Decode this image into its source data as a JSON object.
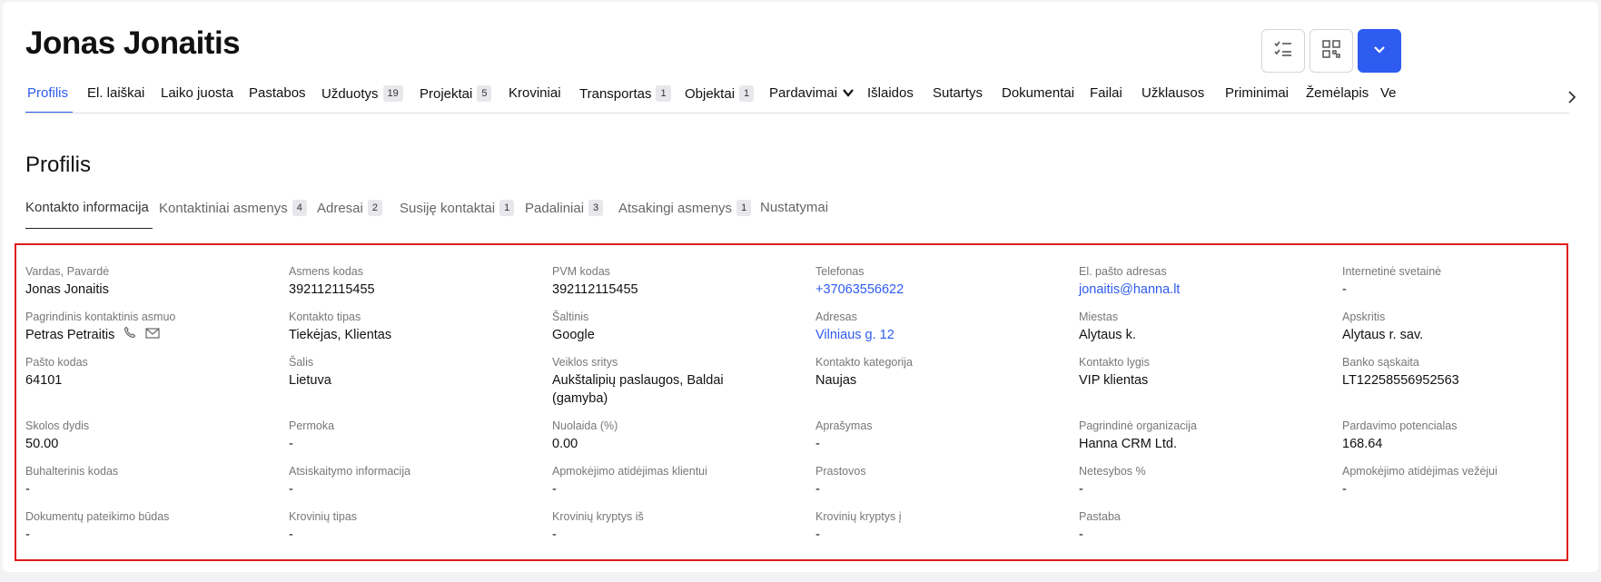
{
  "header": {
    "title": "Jonas Jonaitis"
  },
  "header_buttons": {
    "icons": [
      "checklist-icon",
      "qr-code-icon",
      "chevron-down-icon"
    ]
  },
  "tabs": [
    {
      "label": "Profilis",
      "active": true
    },
    {
      "label": "El. laiškai"
    },
    {
      "label": "Laiko juosta"
    },
    {
      "label": "Pastabos"
    },
    {
      "label": "Užduotys",
      "badge": "19"
    },
    {
      "label": "Projektai",
      "badge": "5"
    },
    {
      "label": "Kroviniai"
    },
    {
      "label": "Transportas",
      "badge": "1"
    },
    {
      "label": "Objektai",
      "badge": "1"
    },
    {
      "label": "Pardavimai",
      "dropdown": true
    },
    {
      "label": "Išlaidos"
    },
    {
      "label": "Sutartys"
    },
    {
      "label": "Dokumentai"
    },
    {
      "label": "Failai"
    },
    {
      "label": "Užklausos"
    },
    {
      "label": "Priminimai"
    },
    {
      "label": "Žemėlapis"
    },
    {
      "label": "Ve"
    }
  ],
  "section": {
    "title": "Profilis"
  },
  "subtabs": [
    {
      "label": "Kontakto informacija",
      "active": true
    },
    {
      "label": "Kontaktiniai asmenys",
      "badge": "4"
    },
    {
      "label": "Adresai",
      "badge": "2"
    },
    {
      "label": "Susiję kontaktai",
      "badge": "1"
    },
    {
      "label": "Padaliniai",
      "badge": "3"
    },
    {
      "label": "Atsakingi asmenys",
      "badge": "1"
    },
    {
      "label": "Nustatymai"
    }
  ],
  "fields": {
    "full_name": {
      "label": "Vardas, Pavardė",
      "value": "Jonas Jonaitis"
    },
    "personal_code": {
      "label": "Asmens kodas",
      "value": "392112115455"
    },
    "vat_code": {
      "label": "PVM kodas",
      "value": "392112115455"
    },
    "phone": {
      "label": "Telefonas",
      "value": "+37063556622"
    },
    "email": {
      "label": "El. pašto adresas",
      "value": "jonaitis@hanna.lt"
    },
    "website": {
      "label": "Internetinė svetainė",
      "value": "-"
    },
    "main_contact": {
      "label": "Pagrindinis kontaktinis asmuo",
      "value": "Petras Petraitis"
    },
    "contact_type": {
      "label": "Kontakto tipas",
      "value": "Tiekėjas, Klientas"
    },
    "source": {
      "label": "Šaltinis",
      "value": "Google"
    },
    "address": {
      "label": "Adresas",
      "value": "Vilniaus g. 12"
    },
    "city": {
      "label": "Miestas",
      "value": "Alytaus k."
    },
    "county": {
      "label": "Apskritis",
      "value": "Alytaus r. sav."
    },
    "postal_code": {
      "label": "Pašto kodas",
      "value": "64101"
    },
    "country": {
      "label": "Šalis",
      "value": "Lietuva"
    },
    "activity": {
      "label": "Veiklos sritys",
      "value": "Aukštalipių paslaugos, Baldai (gamyba)"
    },
    "contact_category": {
      "label": "Kontakto kategorija",
      "value": "Naujas"
    },
    "contact_level": {
      "label": "Kontakto lygis",
      "value": "VIP klientas"
    },
    "bank_account": {
      "label": "Banko sąskaita",
      "value": "LT12258556952563"
    },
    "debt": {
      "label": "Skolos dydis",
      "value": "50.00"
    },
    "overpayment": {
      "label": "Permoka",
      "value": "-"
    },
    "discount": {
      "label": "Nuolaida (%)",
      "value": "0.00"
    },
    "description": {
      "label": "Aprašymas",
      "value": "-"
    },
    "main_org": {
      "label": "Pagrindinė organizacija",
      "value": "Hanna CRM Ltd."
    },
    "sales_potential": {
      "label": "Pardavimo potencialas",
      "value": "168.64"
    },
    "accounting_code": {
      "label": "Buhalterinis kodas",
      "value": "-"
    },
    "settlement_info": {
      "label": "Atsiskaitymo informacija",
      "value": "-"
    },
    "payment_delay_client": {
      "label": "Apmokėjimo atidėjimas klientui",
      "value": "-"
    },
    "downtime": {
      "label": "Prastovos",
      "value": "-"
    },
    "penalty": {
      "label": "Netesybos %",
      "value": "-"
    },
    "payment_delay_carrier": {
      "label": "Apmokėjimo atidėjimas vežėjui",
      "value": "-"
    },
    "doc_submission": {
      "label": "Dokumentų pateikimo būdas",
      "value": "-"
    },
    "cargo_type": {
      "label": "Krovinių tipas",
      "value": "-"
    },
    "cargo_from": {
      "label": "Krovinių kryptys iš",
      "value": "-"
    },
    "cargo_to": {
      "label": "Krovinių kryptys į",
      "value": "-"
    },
    "note": {
      "label": "Pastaba",
      "value": "-"
    }
  },
  "colors": {
    "accent": "#2e5bf0",
    "highlight_frame": "#e01c1c"
  }
}
